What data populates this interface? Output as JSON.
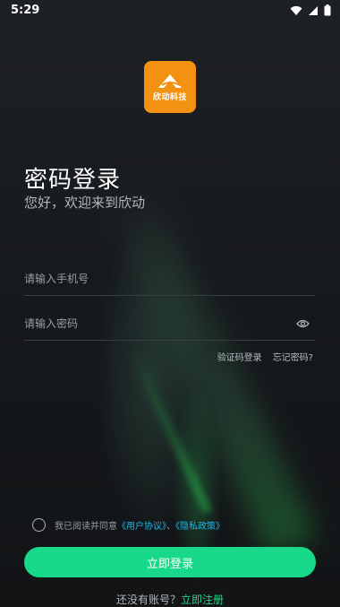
{
  "status_bar": {
    "time": "5:29"
  },
  "logo": {
    "text": "欣动科技"
  },
  "header": {
    "title": "密码登录",
    "subtitle": "您好，欢迎来到欣动"
  },
  "form": {
    "phone_placeholder": "请输入手机号",
    "password_placeholder": "请输入密码"
  },
  "links": {
    "sms_login": "验证码登录",
    "forgot_password": "忘记密码?"
  },
  "agreement": {
    "prefix": "我已阅读并同意",
    "user_agreement": "《用户协议》",
    "separator": "、",
    "privacy_policy": "《隐私政策》"
  },
  "login_button": "立即登录",
  "register": {
    "prompt": "还没有账号？",
    "link": "立即注册"
  },
  "colors": {
    "accent": "#18d889",
    "link": "#20b4e8",
    "logo_bg": "#f39112"
  }
}
